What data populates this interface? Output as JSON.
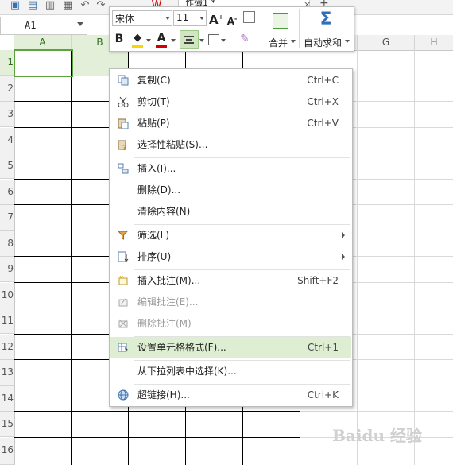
{
  "toolbar": {
    "doc_tab": "作簿1 *",
    "close_glyph": "×",
    "add_glyph": "+"
  },
  "namebox": {
    "value": "A1"
  },
  "columns": [
    "A",
    "B",
    "C",
    "D",
    "E",
    "F",
    "G",
    "H"
  ],
  "rows": [
    "1",
    "2",
    "3",
    "4",
    "5",
    "6",
    "7",
    "8",
    "9",
    "10",
    "11",
    "12",
    "13",
    "14",
    "15",
    "16"
  ],
  "mini_toolbar": {
    "font": "宋体",
    "size": "11",
    "grow_font": "A",
    "shrink_font": "A",
    "bold": "B",
    "font_color_glyph": "A",
    "merge_label": "合并",
    "autosum_label": "自动求和",
    "autosum_glyph": "Σ",
    "colors": {
      "highlight": "#f5d800",
      "font_color": "#d40000",
      "selection": "#5aa33f"
    }
  },
  "context_menu": {
    "items": [
      {
        "label": "复制(C)",
        "shortcut": "Ctrl+C",
        "icon": "copy-icon"
      },
      {
        "label": "剪切(T)",
        "shortcut": "Ctrl+X",
        "icon": "scissors-icon"
      },
      {
        "label": "粘贴(P)",
        "shortcut": "Ctrl+V",
        "icon": "paste-icon"
      },
      {
        "label": "选择性粘贴(S)...",
        "shortcut": "",
        "icon": "paste-special-icon"
      },
      {
        "label": "插入(I)...",
        "shortcut": "",
        "icon": "insert-icon"
      },
      {
        "label": "删除(D)...",
        "shortcut": ""
      },
      {
        "label": "清除内容(N)",
        "shortcut": ""
      },
      {
        "label": "筛选(L)",
        "shortcut": "",
        "icon": "filter-icon",
        "submenu": true
      },
      {
        "label": "排序(U)",
        "shortcut": "",
        "icon": "sort-icon",
        "submenu": true
      },
      {
        "label": "插入批注(M)...",
        "shortcut": "Shift+F2",
        "icon": "insert-comment-icon"
      },
      {
        "label": "编辑批注(E)...",
        "shortcut": "",
        "icon": "edit-comment-icon",
        "disabled": true
      },
      {
        "label": "删除批注(M)",
        "shortcut": "",
        "icon": "delete-comment-icon",
        "disabled": true
      },
      {
        "label": "设置单元格格式(F)...",
        "shortcut": "Ctrl+1",
        "icon": "format-cells-icon",
        "highlighted": true
      },
      {
        "label": "从下拉列表中选择(K)...",
        "shortcut": ""
      },
      {
        "label": "超链接(H)...",
        "shortcut": "Ctrl+K",
        "icon": "hyperlink-icon"
      }
    ]
  },
  "watermark": "Baidu 经验"
}
